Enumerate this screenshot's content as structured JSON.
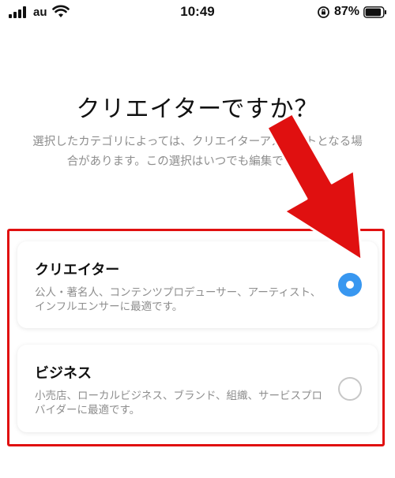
{
  "status_bar": {
    "carrier": "au",
    "time": "10:49",
    "battery": "87%",
    "icons": [
      "signal-icon",
      "wifi-icon",
      "rotation-lock-icon",
      "battery-icon"
    ]
  },
  "title": "クリエイターですか？",
  "subtitle": "選択したカテゴリによっては、クリエイターアカウントとなる場合があります。この選択はいつでも編集できます。",
  "options": [
    {
      "label": "クリエイター",
      "description": "公人・著名人、コンテンツプロデューサー、アーティスト、インフルエンサーに最適です。",
      "selected": true
    },
    {
      "label": "ビジネス",
      "description": "小売店、ローカルビジネス、ブランド、組織、サービスプロバイダーに最適です。",
      "selected": false
    }
  ],
  "colors": {
    "radio_selected": "#3897f0",
    "annotation": "#e01010",
    "muted_text": "#8e8e8e"
  }
}
